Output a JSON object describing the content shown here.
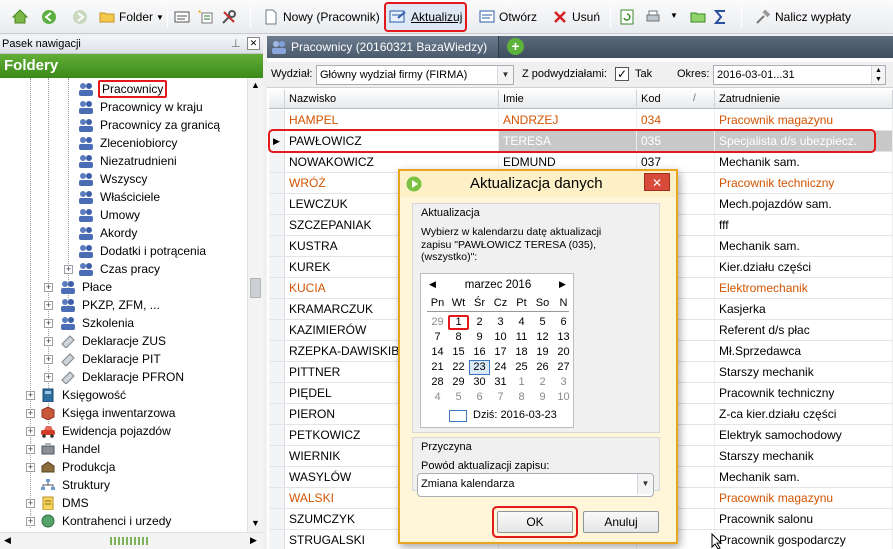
{
  "toolbar": {
    "folder_label": "Folder",
    "new_label": "Nowy (Pracownik)",
    "update_label": "Aktualizuj",
    "open_label": "Otwórz",
    "delete_label": "Usuń",
    "payout_label": "Nalicz wypłaty"
  },
  "nav": {
    "caption": "Pasek nawigacji",
    "header": "Foldery",
    "items": [
      {
        "label": "Pracownicy",
        "level": 3
      },
      {
        "label": "Pracownicy w kraju",
        "level": 3
      },
      {
        "label": "Pracownicy za granicą",
        "level": 3
      },
      {
        "label": "Zleceniobiorcy",
        "level": 3
      },
      {
        "label": "Niezatrudnieni",
        "level": 3
      },
      {
        "label": "Wszyscy",
        "level": 3
      },
      {
        "label": "Właściciele",
        "level": 3
      },
      {
        "label": "Umowy",
        "level": 3
      },
      {
        "label": "Akordy",
        "level": 3
      },
      {
        "label": "Dodatki i potrącenia",
        "level": 3
      },
      {
        "label": "Czas pracy",
        "level": 3
      },
      {
        "label": "Płace",
        "level": 2
      },
      {
        "label": "PKZP, ZFM, ...",
        "level": 2
      },
      {
        "label": "Szkolenia",
        "level": 2
      },
      {
        "label": "Deklaracje ZUS",
        "level": 2
      },
      {
        "label": "Deklaracje PIT",
        "level": 2
      },
      {
        "label": "Deklaracje PFRON",
        "level": 2
      },
      {
        "label": "Księgowość",
        "level": 1
      },
      {
        "label": "Księga inwentarzowa",
        "level": 1
      },
      {
        "label": "Ewidencja pojazdów",
        "level": 1
      },
      {
        "label": "Handel",
        "level": 1
      },
      {
        "label": "Produkcja",
        "level": 1
      },
      {
        "label": "Struktury",
        "level": 1
      },
      {
        "label": "DMS",
        "level": 1
      },
      {
        "label": "Kontrahenci i urzedy",
        "level": 1
      }
    ]
  },
  "main": {
    "tab_title": "Pracownicy (20160321 BazaWiedzy)",
    "filter": {
      "wydzial_label": "Wydział:",
      "wydzial_value": "Główny wydział firmy (FIRMA)",
      "sub_label": "Z podwydziałami:",
      "sub_value": "Tak",
      "okres_label": "Okres:",
      "okres_value": "2016-03-01...31"
    },
    "columns": [
      "Nazwisko",
      "Imie",
      "Kod",
      "Zatrudnienie"
    ],
    "rows": [
      {
        "nazwisko": "HAMPEL",
        "imie": "ANDRZEJ",
        "kod": "034",
        "zatr": "Pracownik magazynu",
        "color": "orange"
      },
      {
        "nazwisko": "PAWŁOWICZ",
        "imie": "TERESA",
        "kod": "035",
        "zatr": "Specjalista d/s ubezpiecz.",
        "color": "selected"
      },
      {
        "nazwisko": "NOWAKOWICZ",
        "imie": "EDMUND",
        "kod": "037",
        "zatr": "Mechanik sam.",
        "color": "normal"
      },
      {
        "nazwisko": "WRÓŻ",
        "imie": "",
        "kod": "",
        "zatr": "Pracownik techniczny",
        "color": "orange"
      },
      {
        "nazwisko": "LEWCZUK",
        "imie": "",
        "kod": "",
        "zatr": "Mech.pojazdów sam.",
        "color": "normal"
      },
      {
        "nazwisko": "SZCZEPANIAK",
        "imie": "",
        "kod": "",
        "zatr": "fff",
        "color": "normal"
      },
      {
        "nazwisko": "KUSTRA",
        "imie": "",
        "kod": "",
        "zatr": "Mechanik sam.",
        "color": "normal"
      },
      {
        "nazwisko": "KUREK",
        "imie": "",
        "kod": "",
        "zatr": "Kier.działu części",
        "color": "normal"
      },
      {
        "nazwisko": "KUCIA",
        "imie": "",
        "kod": "",
        "zatr": "Elektromechanik",
        "color": "orange"
      },
      {
        "nazwisko": "KRAMARCZUK",
        "imie": "",
        "kod": "",
        "zatr": "Kasjerka",
        "color": "normal"
      },
      {
        "nazwisko": "KAZIMIERÓW",
        "imie": "",
        "kod": "",
        "zatr": "Referent d/s płac",
        "color": "normal"
      },
      {
        "nazwisko": "RZEPKA-DAWISKIBA",
        "imie": "",
        "kod": "",
        "zatr": "Mł.Sprzedawca",
        "color": "normal"
      },
      {
        "nazwisko": "PITTNER",
        "imie": "",
        "kod": "",
        "zatr": "Starszy mechanik",
        "color": "normal"
      },
      {
        "nazwisko": "PIĘDEL",
        "imie": "",
        "kod": "",
        "zatr": "Pracownik techniczny",
        "color": "normal"
      },
      {
        "nazwisko": "PIERON",
        "imie": "",
        "kod": "",
        "zatr": "Z-ca kier.działu części",
        "color": "normal"
      },
      {
        "nazwisko": "PETKOWICZ",
        "imie": "",
        "kod": "",
        "zatr": "Elektryk samochodowy",
        "color": "normal"
      },
      {
        "nazwisko": "WIERNIK",
        "imie": "",
        "kod": "",
        "zatr": "Starszy mechanik",
        "color": "normal"
      },
      {
        "nazwisko": "WASYLÓW",
        "imie": "",
        "kod": "",
        "zatr": "Mechanik sam.",
        "color": "normal"
      },
      {
        "nazwisko": "WALSKI",
        "imie": "",
        "kod": "",
        "zatr": "Pracownik magazynu",
        "color": "orange"
      },
      {
        "nazwisko": "SZUMCZYK",
        "imie": "",
        "kod": "",
        "zatr": "Pracownik salonu",
        "color": "normal"
      },
      {
        "nazwisko": "STRUGALSKI",
        "imie": "",
        "kod": "",
        "zatr": "Pracownik gospodarczy",
        "color": "normal"
      }
    ]
  },
  "dialog": {
    "title": "Aktualizacja danych",
    "group1_title": "Aktualizacja",
    "description": "Wybierz w kalendarzu datę aktualizacji zapisu \"PAWŁOWICZ TERESA (035), (wszystko)\":",
    "calendar": {
      "month_label": "marzec 2016",
      "weekdays": [
        "Pn",
        "Wt",
        "Śr",
        "Cz",
        "Pt",
        "So",
        "N"
      ],
      "weeks": [
        [
          "29",
          "1",
          "2",
          "3",
          "4",
          "5",
          "6"
        ],
        [
          "7",
          "8",
          "9",
          "10",
          "11",
          "12",
          "13"
        ],
        [
          "14",
          "15",
          "16",
          "17",
          "18",
          "19",
          "20"
        ],
        [
          "21",
          "22",
          "23",
          "24",
          "25",
          "26",
          "27"
        ],
        [
          "28",
          "29",
          "30",
          "31",
          "1",
          "2",
          "3"
        ],
        [
          "4",
          "5",
          "6",
          "7",
          "8",
          "9",
          "10"
        ]
      ],
      "today_label": "Dziś: 2016-03-23"
    },
    "group2_title": "Przyczyna",
    "reason_label": "Powód aktualizacji zapisu:",
    "reason_value": "Zmiana kalendarza",
    "ok_label": "OK",
    "cancel_label": "Anuluj"
  },
  "colors": {
    "accent_green": "#4a9c26",
    "highlight_red": "#e3191b",
    "orange_text": "#d35400",
    "dialog_border": "#e9a420"
  }
}
